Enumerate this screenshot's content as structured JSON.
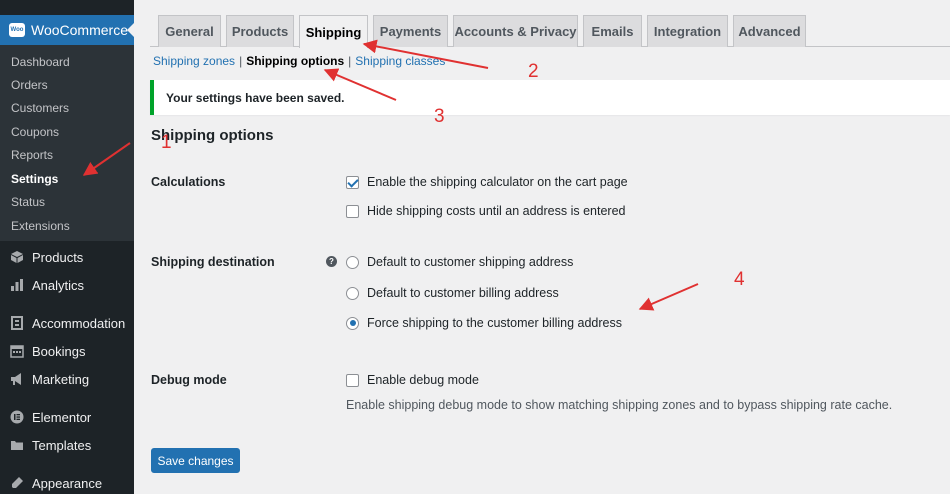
{
  "sidebar": {
    "woocommerce_label": "WooCommerce",
    "woo_logo_text": "Woo",
    "submenu": [
      {
        "label": "Dashboard",
        "active": false
      },
      {
        "label": "Orders",
        "active": false
      },
      {
        "label": "Customers",
        "active": false
      },
      {
        "label": "Coupons",
        "active": false
      },
      {
        "label": "Reports",
        "active": false
      },
      {
        "label": "Settings",
        "active": true
      },
      {
        "label": "Status",
        "active": false
      },
      {
        "label": "Extensions",
        "active": false
      }
    ],
    "menu": [
      {
        "label": "Products",
        "icon": "products-icon"
      },
      {
        "label": "Analytics",
        "icon": "analytics-icon"
      },
      {
        "label": "Accommodation",
        "icon": "accommodation-icon"
      },
      {
        "label": "Bookings",
        "icon": "bookings-icon"
      },
      {
        "label": "Marketing",
        "icon": "marketing-icon"
      },
      {
        "label": "Elementor",
        "icon": "elementor-icon"
      },
      {
        "label": "Templates",
        "icon": "templates-icon"
      },
      {
        "label": "Appearance",
        "icon": "appearance-icon"
      }
    ]
  },
  "tabs": [
    {
      "label": "General",
      "active": false
    },
    {
      "label": "Products",
      "active": false
    },
    {
      "label": "Shipping",
      "active": true
    },
    {
      "label": "Payments",
      "active": false
    },
    {
      "label": "Accounts & Privacy",
      "active": false
    },
    {
      "label": "Emails",
      "active": false
    },
    {
      "label": "Integration",
      "active": false
    },
    {
      "label": "Advanced",
      "active": false
    }
  ],
  "subnav": {
    "zones": "Shipping zones",
    "sep": "|",
    "options": "Shipping options",
    "classes": "Shipping classes"
  },
  "notice": "Your settings have been saved.",
  "section_title": "Shipping options",
  "calculations": {
    "label": "Calculations",
    "opt1": {
      "label": "Enable the shipping calculator on the cart page",
      "checked": true
    },
    "opt2": {
      "label": "Hide shipping costs until an address is entered",
      "checked": false
    }
  },
  "destination": {
    "label": "Shipping destination",
    "help": "?",
    "options": [
      {
        "label": "Default to customer shipping address",
        "checked": false
      },
      {
        "label": "Default to customer billing address",
        "checked": false
      },
      {
        "label": "Force shipping to the customer billing address",
        "checked": true
      }
    ]
  },
  "debug": {
    "label": "Debug mode",
    "opt": {
      "label": "Enable debug mode",
      "checked": false
    },
    "description": "Enable shipping debug mode to show matching shipping zones and to bypass shipping rate cache."
  },
  "save_label": "Save changes",
  "annotations": {
    "n1": "1",
    "n2": "2",
    "n3": "3",
    "n4": "4",
    "color": "#e03131"
  },
  "colors": {
    "sidebar_bg": "#1d2327",
    "accent": "#2271b1",
    "success": "#00a32a"
  }
}
